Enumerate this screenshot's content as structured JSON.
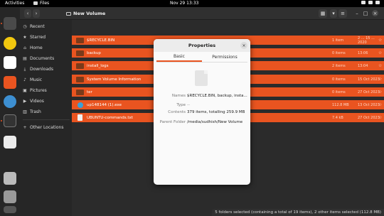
{
  "topbar": {
    "activities": "Activities",
    "app_name": "Files",
    "clock": "Nov 29  13:33"
  },
  "header": {
    "back": "‹",
    "forward": "›",
    "location": "New Volume",
    "view_icon": "grid-icon",
    "sort_icon": "sort-icon",
    "menu_icon": "hamburger-icon"
  },
  "sidebar": {
    "items": [
      {
        "label": "Recent",
        "icon": "clock-icon"
      },
      {
        "label": "Starred",
        "icon": "star-icon"
      },
      {
        "label": "Home",
        "icon": "home-icon"
      },
      {
        "label": "Documents",
        "icon": "documents-icon"
      },
      {
        "label": "Downloads",
        "icon": "downloads-icon"
      },
      {
        "label": "Music",
        "icon": "music-icon"
      },
      {
        "label": "Pictures",
        "icon": "pictures-icon"
      },
      {
        "label": "Videos",
        "icon": "videos-icon"
      },
      {
        "label": "Trash",
        "icon": "trash-icon"
      }
    ],
    "other_locations": "Other Locations"
  },
  "files": [
    {
      "name": "$RECYCLE.BIN",
      "size": "1 item",
      "modified": "2 ... 15 ... 2020",
      "type": "folder"
    },
    {
      "name": "backup",
      "size": "0 items",
      "modified": "13:06",
      "type": "folder"
    },
    {
      "name": "install_logs",
      "size": "2 items",
      "modified": "13:04",
      "type": "folder"
    },
    {
      "name": "System Volume Information",
      "size": "0 items",
      "modified": "15 Oct 2023",
      "type": "folder"
    },
    {
      "name": "ter",
      "size": "0 items",
      "modified": "27 Oct 2023",
      "type": "folder"
    },
    {
      "name": "up148144 (1).exe",
      "size": "112.8 MB",
      "modified": "13 Oct 2023",
      "type": "exe"
    },
    {
      "name": "UBUNTU-commands.txt",
      "size": "7.4 kB",
      "modified": "27 Oct 2023",
      "type": "txt"
    }
  ],
  "status": "5 folders selected (containing a total of 19 items), 2 other items selected (112.8 MB)",
  "dialog": {
    "title": "Properties",
    "tabs": [
      "Basic",
      "Permissions"
    ],
    "fields": [
      {
        "key": "Names",
        "value": "$RECYCLE.BIN, backup, insta..."
      },
      {
        "key": "Type",
        "value": "--"
      },
      {
        "key": "Contents",
        "value": "379 items, totalling 259.9 MB"
      },
      {
        "key": "Parent Folder",
        "value": "/media/sudhish/New Volume"
      }
    ]
  },
  "colors": {
    "accent": "#e95420",
    "background": "#2b2b2b",
    "dialog_bg": "#fafafa"
  }
}
